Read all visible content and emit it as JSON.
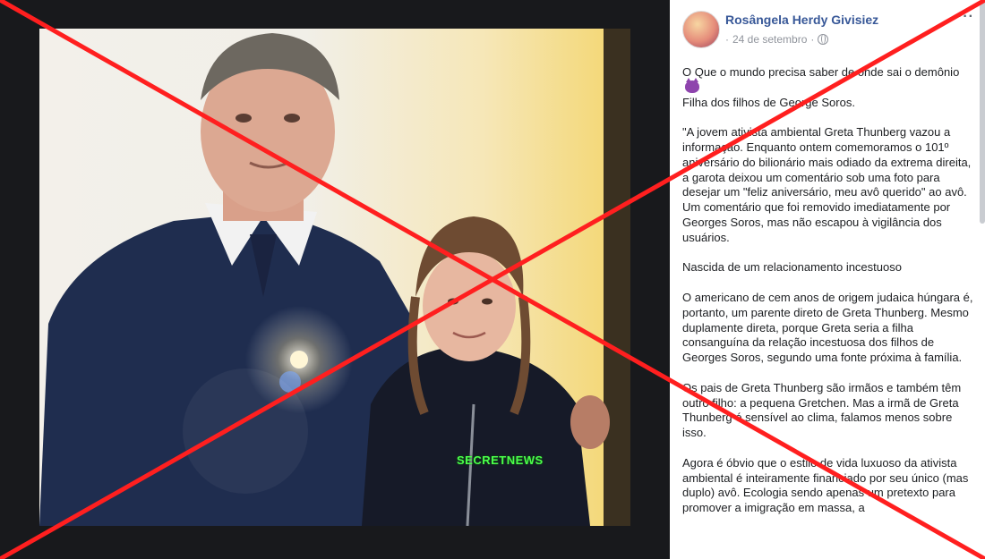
{
  "post": {
    "author": "Rosângela Herdy Givisiez",
    "date": "24 de setembro",
    "separator": "·",
    "more_label": "···",
    "paragraphs": [
      [
        "O Que o mundo precisa saber de onde sai o demônio",
        "Filha dos filhos de George Soros."
      ],
      [
        "\"A jovem ativista ambiental Greta Thunberg vazou a informação. Enquanto ontem comemoramos o 101º aniversário do bilionário mais odiado da extrema direita, a garota deixou um comentário sob uma foto para desejar um \"feliz aniversário, meu avô querido\" ao avô. Um comentário que foi removido imediatamente por Georges Soros, mas não escapou à vigilância dos usuários."
      ],
      [
        "Nascida de um relacionamento incestuoso"
      ],
      [
        "O americano de cem anos de origem judaica húngara é, portanto, um parente direto de Greta Thunberg. Mesmo duplamente direta, porque Greta seria a filha consanguína da relação incestuosa dos filhos de Georges Soros, segundo uma fonte próxima à família."
      ],
      [
        "Os pais de Greta Thunberg são irmãos e também têm outro filho: a pequena Gretchen. Mas a irmã de Greta Thunberg é sensível ao clima, falamos menos sobre isso."
      ],
      [
        "Agora é óbvio que o estilo de vida luxuoso da ativista ambiental é inteiramente financiado por seu único (mas duplo) avô. Ecologia sendo apenas um pretexto para promover a imigração em massa, a"
      ]
    ],
    "emoji_icon": "smiling-devil-emoji"
  },
  "photo": {
    "watermark": "SECRETNEWS"
  },
  "overlay": {
    "color": "#ff1f1f",
    "icon": "red-x-cross"
  }
}
